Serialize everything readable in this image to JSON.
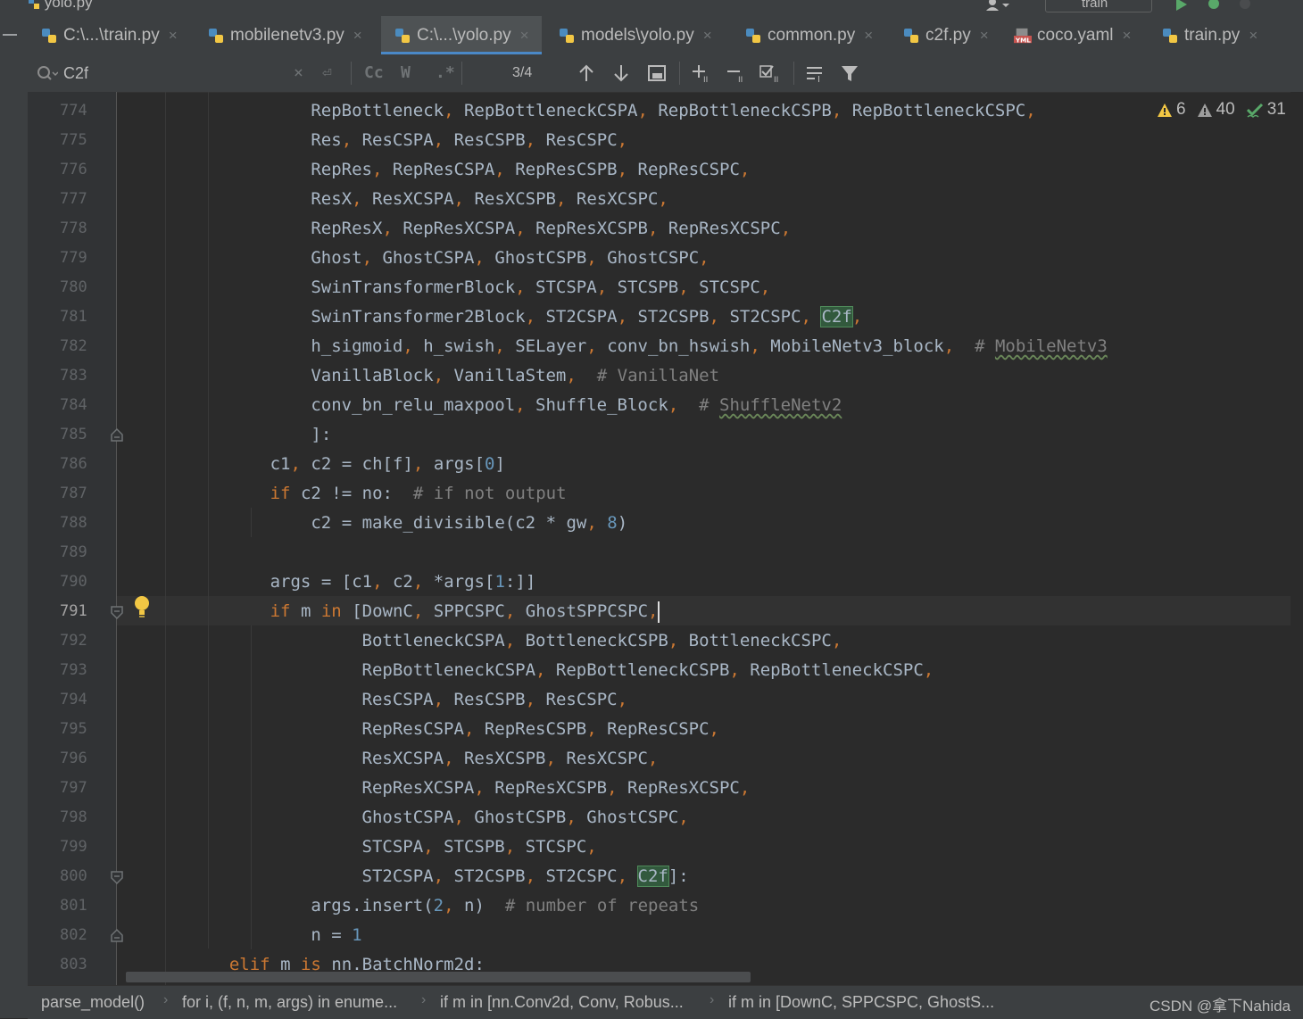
{
  "window": {
    "title": "yolo.py",
    "run_config": "train"
  },
  "tabs": [
    {
      "label": "C:\\...\\train.py",
      "icon": "python-file-icon",
      "active": false
    },
    {
      "label": "mobilenetv3.py",
      "icon": "python-file-icon",
      "active": false
    },
    {
      "label": "C:\\...\\yolo.py",
      "icon": "python-file-icon",
      "active": true
    },
    {
      "label": "models\\yolo.py",
      "icon": "python-file-icon",
      "active": false
    },
    {
      "label": "common.py",
      "icon": "python-file-icon",
      "active": false
    },
    {
      "label": "c2f.py",
      "icon": "python-file-icon",
      "active": false
    },
    {
      "label": "coco.yaml",
      "icon": "yaml-file-icon",
      "active": false
    },
    {
      "label": "train.py",
      "icon": "python-file-icon",
      "active": false
    }
  ],
  "search": {
    "query": "C2f",
    "match_case_label": "Cc",
    "whole_words_label": "W",
    "regex_label": ".*",
    "match_count": "3/4"
  },
  "inspections": {
    "errors": "6",
    "warnings": "40",
    "typos": "31"
  },
  "code": {
    "current_line": 791,
    "lines": [
      {
        "n": "774",
        "text": "                RepBottleneck, RepBottleneckCSPA, RepBottleneckCSPB, RepBottleneckCSPC,"
      },
      {
        "n": "775",
        "text": "                Res, ResCSPA, ResCSPB, ResCSPC,"
      },
      {
        "n": "776",
        "text": "                RepRes, RepResCSPA, RepResCSPB, RepResCSPC,"
      },
      {
        "n": "777",
        "text": "                ResX, ResXCSPA, ResXCSPB, ResXCSPC,"
      },
      {
        "n": "778",
        "text": "                RepResX, RepResXCSPA, RepResXCSPB, RepResXCSPC,"
      },
      {
        "n": "779",
        "text": "                Ghost, GhostCSPA, GhostCSPB, GhostCSPC,"
      },
      {
        "n": "780",
        "text": "                SwinTransformerBlock, STCSPA, STCSPB, STCSPC,"
      },
      {
        "n": "781",
        "text": "                SwinTransformer2Block, ST2CSPA, ST2CSPB, ST2CSPC, C2f,"
      },
      {
        "n": "782",
        "text": "                h_sigmoid, h_swish, SELayer, conv_bn_hswish, MobileNetv3_block,  # MobileNetv3"
      },
      {
        "n": "783",
        "text": "                VanillaBlock, VanillaStem,  # VanillaNet"
      },
      {
        "n": "784",
        "text": "                conv_bn_relu_maxpool, Shuffle_Block,  # ShuffleNetv2"
      },
      {
        "n": "785",
        "text": "                ]:"
      },
      {
        "n": "786",
        "text": "            c1, c2 = ch[f], args[0]"
      },
      {
        "n": "787",
        "text": "            if c2 != no:  # if not output"
      },
      {
        "n": "788",
        "text": "                c2 = make_divisible(c2 * gw, 8)"
      },
      {
        "n": "789",
        "text": ""
      },
      {
        "n": "790",
        "text": "            args = [c1, c2, *args[1:]]"
      },
      {
        "n": "791",
        "text": "            if m in [DownC, SPPCSPC, GhostSPPCSPC,"
      },
      {
        "n": "792",
        "text": "                     BottleneckCSPA, BottleneckCSPB, BottleneckCSPC,"
      },
      {
        "n": "793",
        "text": "                     RepBottleneckCSPA, RepBottleneckCSPB, RepBottleneckCSPC,"
      },
      {
        "n": "794",
        "text": "                     ResCSPA, ResCSPB, ResCSPC,"
      },
      {
        "n": "795",
        "text": "                     RepResCSPA, RepResCSPB, RepResCSPC,"
      },
      {
        "n": "796",
        "text": "                     ResXCSPA, ResXCSPB, ResXCSPC,"
      },
      {
        "n": "797",
        "text": "                     RepResXCSPA, RepResXCSPB, RepResXCSPC,"
      },
      {
        "n": "798",
        "text": "                     GhostCSPA, GhostCSPB, GhostCSPC,"
      },
      {
        "n": "799",
        "text": "                     STCSPA, STCSPB, STCSPC,"
      },
      {
        "n": "800",
        "text": "                     ST2CSPA, ST2CSPB, ST2CSPC, C2f]:"
      },
      {
        "n": "801",
        "text": "                args.insert(2, n)  # number of repeats"
      },
      {
        "n": "802",
        "text": "                n = 1"
      },
      {
        "n": "803",
        "text": "        elif m is nn.BatchNorm2d:"
      }
    ]
  },
  "breadcrumbs": [
    "parse_model()",
    "for i, (f, n, m, args) in enume...",
    "if m in [nn.Conv2d, Conv, Robus...",
    "if m in [DownC, SPPCSPC, GhostS..."
  ],
  "watermark": "CSDN @拿下Nahida",
  "colors": {
    "editor_bg": "#2b2b2b",
    "keyword": "#cc7832",
    "number": "#6897bb",
    "comment": "#808080",
    "search_highlight": "#32593d",
    "active_tab_underline": "#4a88c7"
  }
}
